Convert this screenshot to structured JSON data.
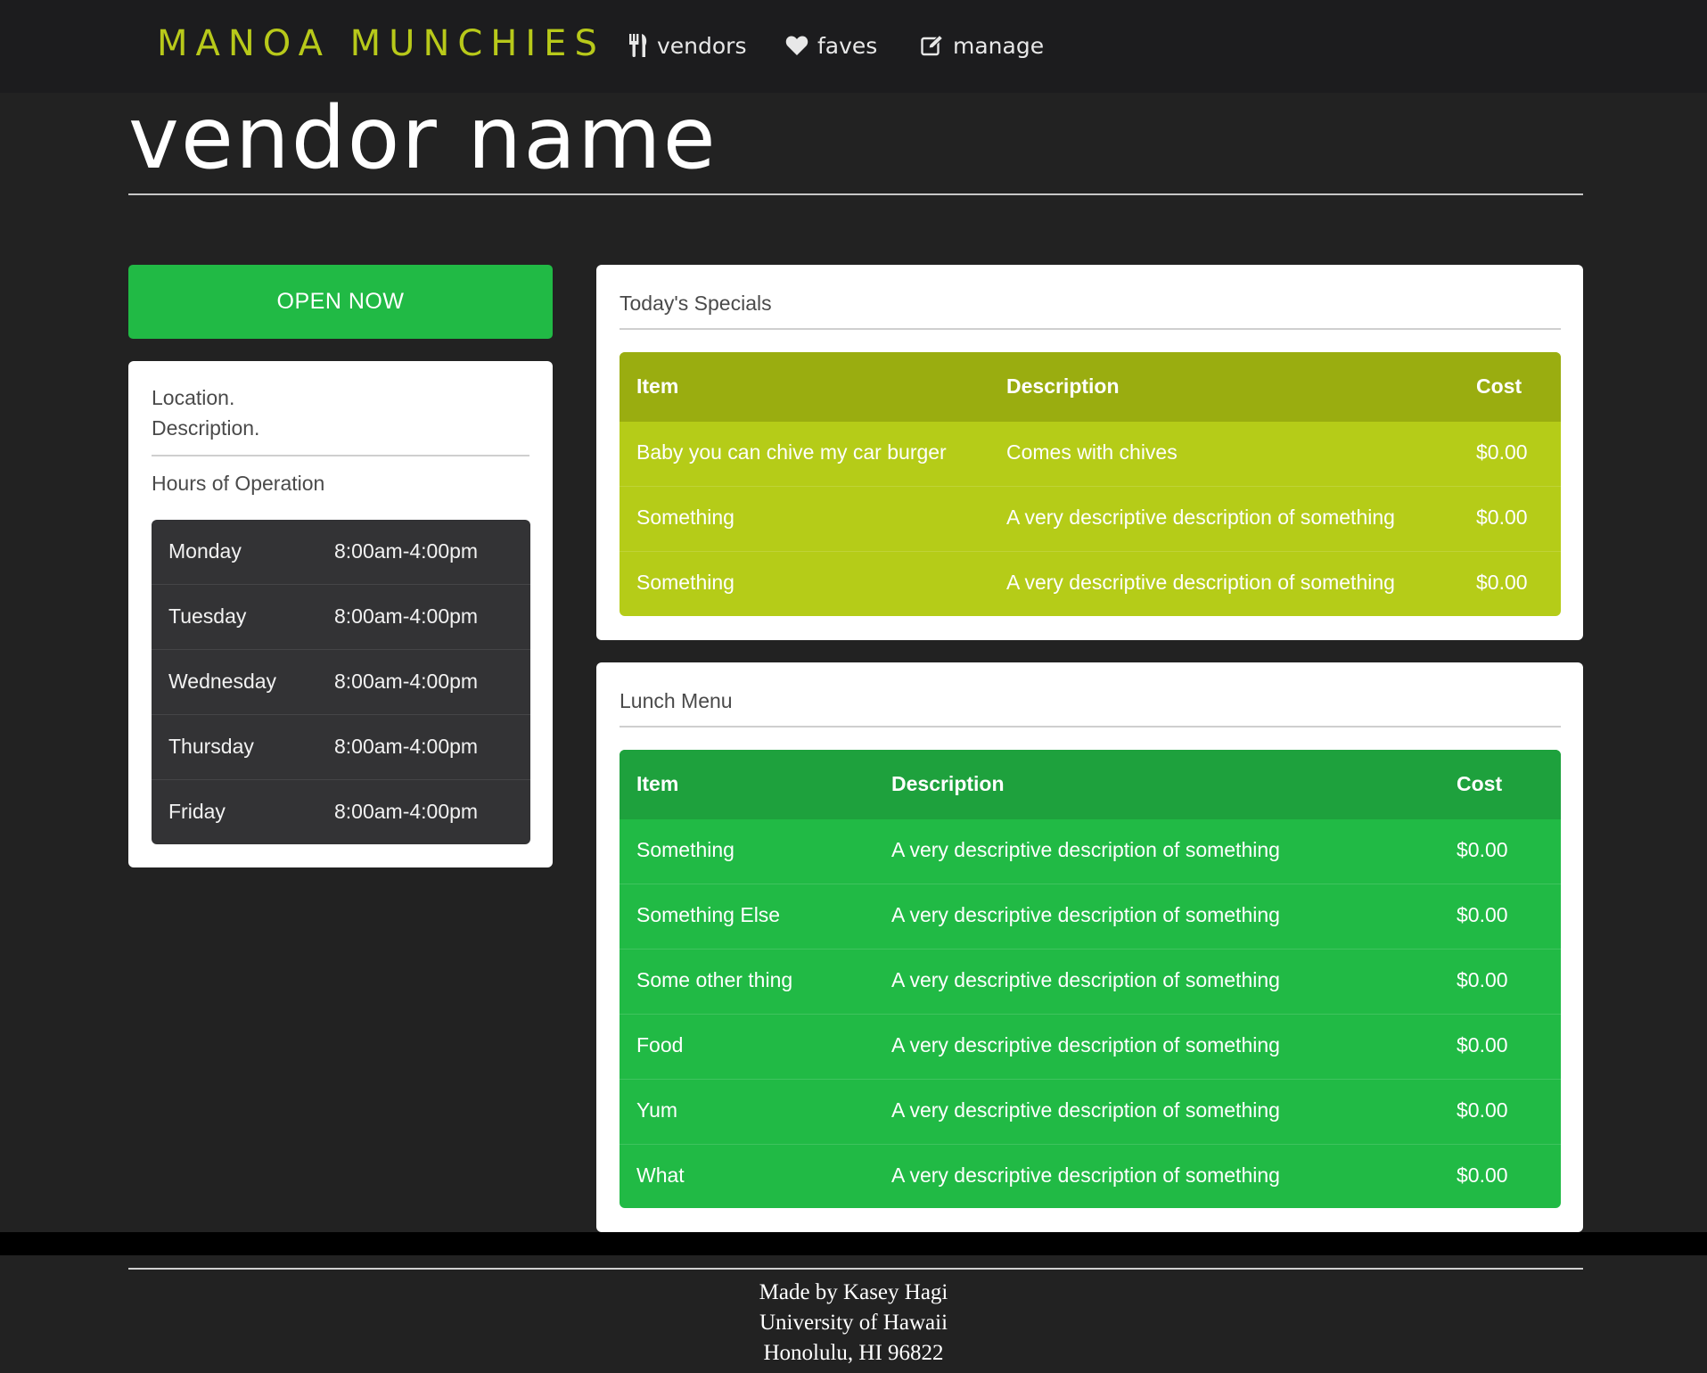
{
  "nav": {
    "brand": "MANOA MUNCHIES",
    "items": [
      {
        "label": "vendors",
        "icon": "utensils-icon"
      },
      {
        "label": "faves",
        "icon": "heart-icon"
      },
      {
        "label": "manage",
        "icon": "edit-icon"
      }
    ]
  },
  "vendor": {
    "name": "vendor name",
    "status_button": "OPEN NOW",
    "location": "Location.",
    "description": "Description.",
    "hours_label": "Hours of Operation",
    "hours": [
      {
        "day": "Monday",
        "time": "8:00am-4:00pm"
      },
      {
        "day": "Tuesday",
        "time": "8:00am-4:00pm"
      },
      {
        "day": "Wednesday",
        "time": "8:00am-4:00pm"
      },
      {
        "day": "Thursday",
        "time": "8:00am-4:00pm"
      },
      {
        "day": "Friday",
        "time": "8:00am-4:00pm"
      }
    ]
  },
  "specials": {
    "heading": "Today's Specials",
    "columns": [
      "Item",
      "Description",
      "Cost"
    ],
    "rows": [
      {
        "item": "Baby you can chive my car burger",
        "description": "Comes with chives",
        "cost": "$0.00"
      },
      {
        "item": "Something",
        "description": "A very descriptive description of something",
        "cost": "$0.00"
      },
      {
        "item": "Something",
        "description": "A very descriptive description of something",
        "cost": "$0.00"
      }
    ]
  },
  "lunch": {
    "heading": "Lunch Menu",
    "columns": [
      "Item",
      "Description",
      "Cost"
    ],
    "rows": [
      {
        "item": "Something",
        "description": "A very descriptive description of something",
        "cost": "$0.00"
      },
      {
        "item": "Something Else",
        "description": "A very descriptive description of something",
        "cost": "$0.00"
      },
      {
        "item": "Some other thing",
        "description": "A very descriptive description of something",
        "cost": "$0.00"
      },
      {
        "item": "Food",
        "description": "A very descriptive description of something",
        "cost": "$0.00"
      },
      {
        "item": "Yum",
        "description": "A very descriptive description of something",
        "cost": "$0.00"
      },
      {
        "item": "What",
        "description": "A very descriptive description of something",
        "cost": "$0.00"
      }
    ]
  },
  "footer": {
    "line1": "Made by Kasey Hagi",
    "line2": "University of Hawaii",
    "line3": "Honolulu, HI 96822"
  },
  "colors": {
    "brand": "#b8c91a",
    "open_green": "#21ba45",
    "specials_olive": "#b5cc18",
    "page_bg": "#222222"
  }
}
